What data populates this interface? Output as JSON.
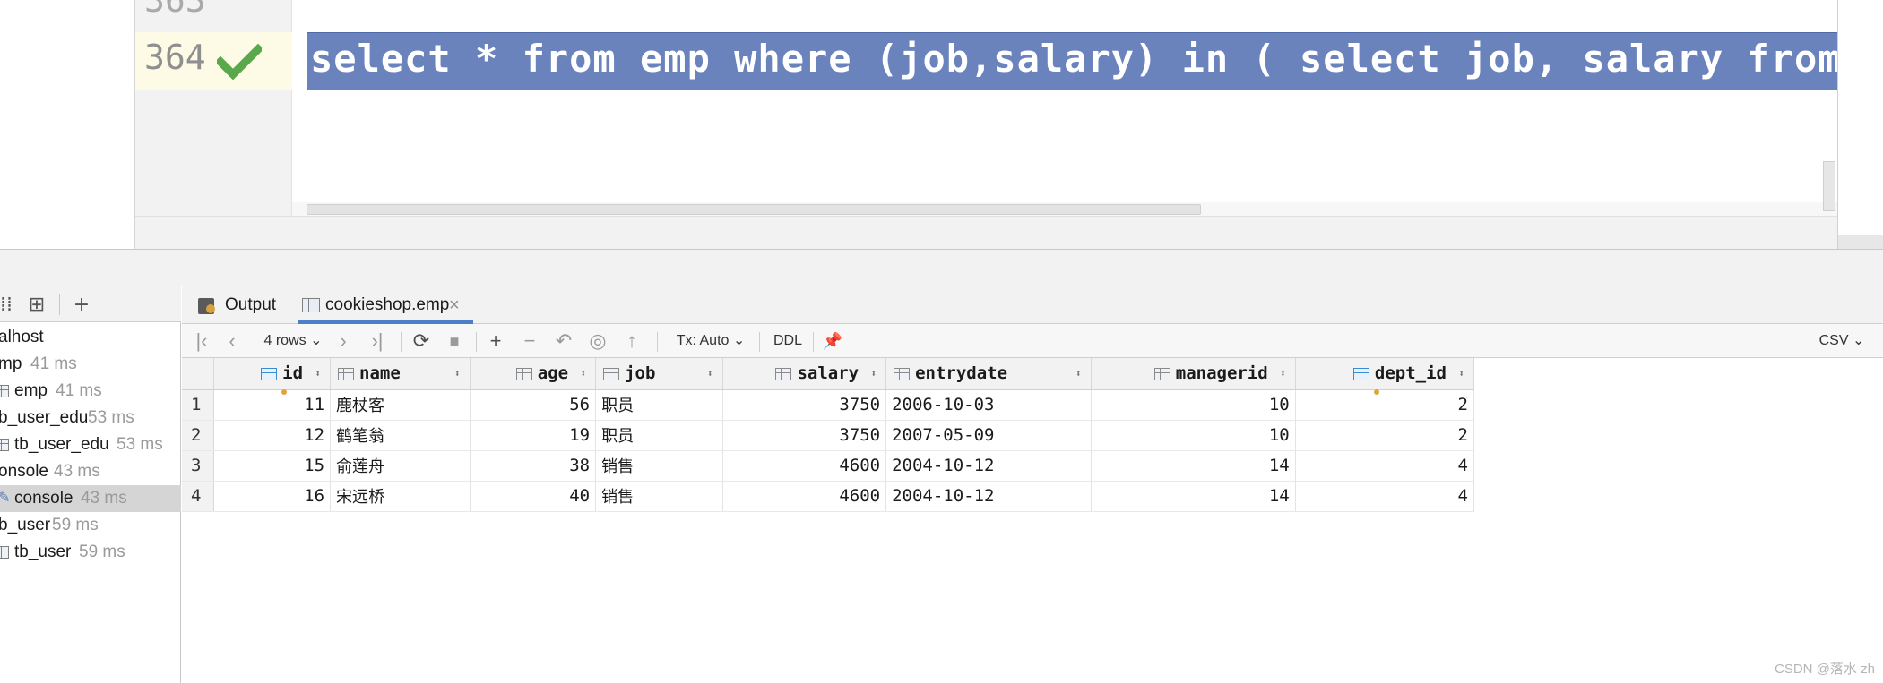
{
  "editor": {
    "prev_line_number": "363",
    "current_line_number": "364",
    "sql": "select * from emp where (job,salary) in ( select job, salary from emp"
  },
  "tree": {
    "items": [
      {
        "name": "alhost",
        "time": ""
      },
      {
        "name": "mp",
        "time": "41 ms"
      },
      {
        "name": "emp",
        "time": "41 ms"
      },
      {
        "name": "b_user_edu",
        "time": "53 ms"
      },
      {
        "name": "tb_user_edu",
        "time": "53 ms"
      },
      {
        "name": "onsole",
        "time": "43 ms"
      },
      {
        "name": "console",
        "time": "43 ms"
      },
      {
        "name": "b_user",
        "time": "59 ms"
      },
      {
        "name": "tb_user",
        "time": "59 ms"
      }
    ]
  },
  "tabs": {
    "output": "Output",
    "table": "cookieshop.emp",
    "close": "×"
  },
  "toolbar": {
    "rows": "4 rows",
    "tx": "Tx: Auto",
    "ddl": "DDL",
    "csv": "CSV"
  },
  "grid": {
    "columns": [
      "id",
      "name",
      "age",
      "job",
      "salary",
      "entrydate",
      "managerid",
      "dept_id"
    ],
    "rows": [
      {
        "n": "1",
        "id": "11",
        "name": "鹿杖客",
        "age": "56",
        "job": "职员",
        "salary": "3750",
        "entrydate": "2006-10-03",
        "managerid": "10",
        "dept_id": "2"
      },
      {
        "n": "2",
        "id": "12",
        "name": "鹤笔翁",
        "age": "19",
        "job": "职员",
        "salary": "3750",
        "entrydate": "2007-05-09",
        "managerid": "10",
        "dept_id": "2"
      },
      {
        "n": "3",
        "id": "15",
        "name": "俞莲舟",
        "age": "38",
        "job": "销售",
        "salary": "4600",
        "entrydate": "2004-10-12",
        "managerid": "14",
        "dept_id": "4"
      },
      {
        "n": "4",
        "id": "16",
        "name": "宋远桥",
        "age": "40",
        "job": "销售",
        "salary": "4600",
        "entrydate": "2004-10-12",
        "managerid": "14",
        "dept_id": "4"
      }
    ]
  },
  "watermark": "CSDN @落水 zh",
  "colors": {
    "selection": "#6a83bd",
    "check": "#59a84b",
    "active_tab": "#4b7fc8"
  }
}
